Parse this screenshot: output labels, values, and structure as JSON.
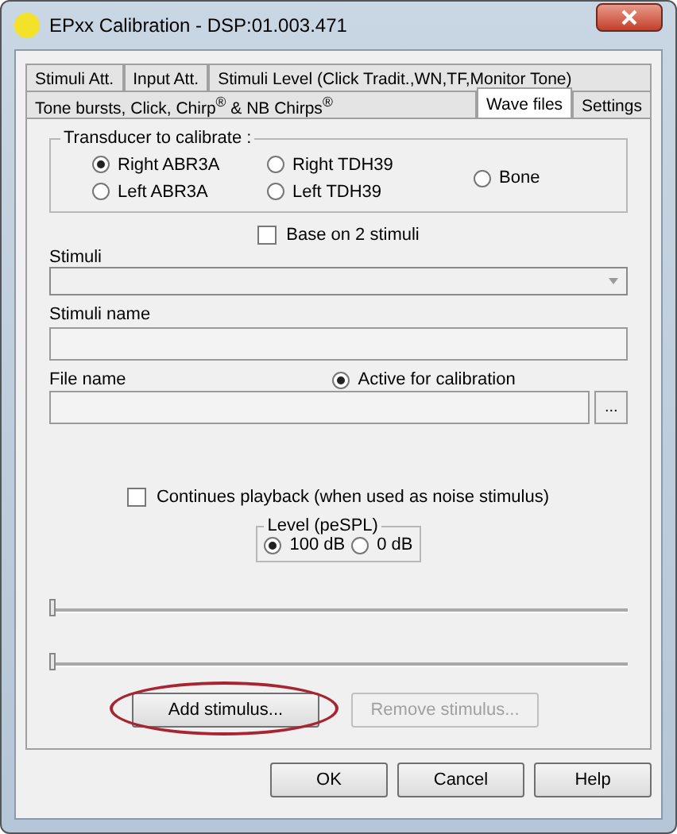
{
  "window": {
    "title": "EPxx Calibration - DSP:01.003.471"
  },
  "tab_rows": [
    [
      {
        "label": "Stimuli Att.",
        "selected": false
      },
      {
        "label": "Input Att.",
        "selected": false
      },
      {
        "label": "Stimuli Level (Click Tradit.,WN,TF,Monitor Tone)",
        "selected": false
      }
    ],
    [
      {
        "label": "Tone bursts, Click, Chirp$^{®}$ & NB Chirps$^{®}$",
        "selected": false
      },
      {
        "label": "Wave files",
        "selected": true
      },
      {
        "label": "Settings",
        "selected": false
      }
    ]
  ],
  "transducer": {
    "title": "Transducer to calibrate :",
    "options": [
      {
        "label": "Right ABR3A",
        "selected": true
      },
      {
        "label": "Left ABR3A",
        "selected": false
      },
      {
        "label": "Right TDH39",
        "selected": false
      },
      {
        "label": "Left TDH39",
        "selected": false
      },
      {
        "label": "Bone",
        "selected": false
      }
    ]
  },
  "base_on_2_stimuli": {
    "label": "Base on 2 stimuli",
    "checked": false
  },
  "stimuli": {
    "label": "Stimuli"
  },
  "stimuli_name": {
    "label": "Stimuli name"
  },
  "file_name": {
    "label": "File name",
    "browse": "...",
    "active": {
      "label": "Active for calibration",
      "selected": true
    }
  },
  "continues_playback": {
    "label": "Continues playback (when used as noise stimulus)",
    "checked": false
  },
  "level": {
    "title": "Level (peSPL)",
    "options": [
      {
        "label": "100 dB",
        "selected": true
      },
      {
        "label": "0 dB",
        "selected": false
      }
    ]
  },
  "sliders": [
    {
      "level": 0
    },
    {
      "level": 0
    }
  ],
  "stimulus_buttons": [
    {
      "label": "Add stimulus...",
      "disabled": false,
      "highlighted": true
    },
    {
      "label": "Remove stimulus...",
      "disabled": true,
      "highlighted": false
    }
  ],
  "buttons": [
    "OK",
    "Cancel",
    "Help"
  ]
}
